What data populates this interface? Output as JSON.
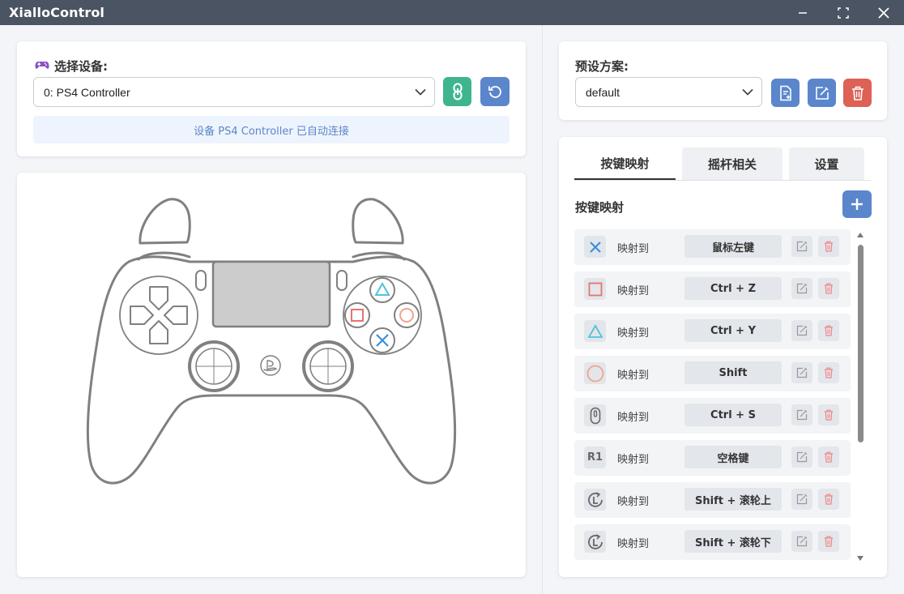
{
  "window": {
    "title": "XialloControl"
  },
  "device": {
    "label": "选择设备:",
    "selected": "0: PS4 Controller",
    "status": "设备 PS4 Controller 已自动连接"
  },
  "preset": {
    "label": "预设方案:",
    "selected": "default"
  },
  "tabs": [
    {
      "label": "按键映射",
      "active": true
    },
    {
      "label": "摇杆相关",
      "active": false
    },
    {
      "label": "设置",
      "active": false
    }
  ],
  "mapping": {
    "section_title": "按键映射",
    "map_text": "映射到",
    "rows": [
      {
        "icon": "cross-button-icon",
        "key": "鼠标左键"
      },
      {
        "icon": "square-button-icon",
        "key": "Ctrl + Z"
      },
      {
        "icon": "triangle-button-icon",
        "key": "Ctrl + Y"
      },
      {
        "icon": "circle-button-icon",
        "key": "Shift"
      },
      {
        "icon": "mouse-scroll-icon",
        "key": "Ctrl + S",
        "label": ""
      },
      {
        "icon": "r1-button-icon",
        "key": "空格键",
        "label": "R1"
      },
      {
        "icon": "left-stick-rotate-icon",
        "key": "Shift + 滚轮上"
      },
      {
        "icon": "left-stick-rotate-icon",
        "key": "Shift + 滚轮下"
      }
    ]
  },
  "colors": {
    "titlebar": "#4a5462",
    "accent_blue": "#5b86cc",
    "accent_green": "#3fb58f",
    "accent_red": "#dd6155",
    "cross": "#3d8fd8",
    "square": "#e57373",
    "triangle": "#4fc3d9",
    "circle": "#f2a38e"
  }
}
